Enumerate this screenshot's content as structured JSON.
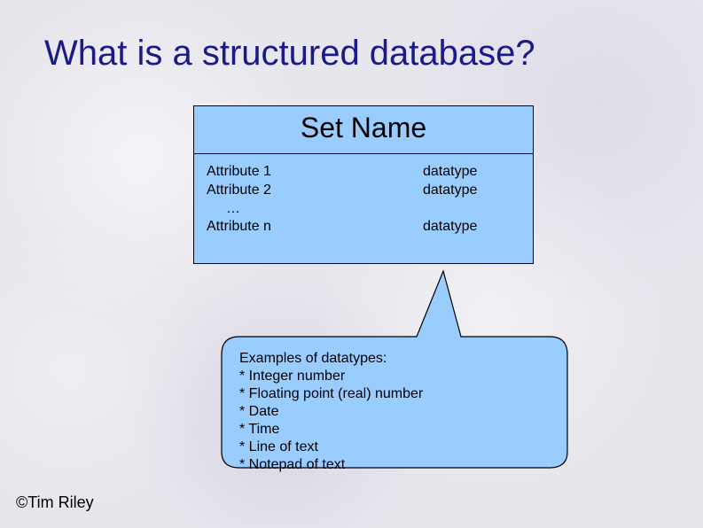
{
  "title": "What is a structured database?",
  "set": {
    "name": "Set Name",
    "rows": {
      "attr1": "Attribute 1",
      "attr2": "Attribute 2",
      "dots": "…",
      "attrN": "Attribute n",
      "dt1": "datatype",
      "dt2": "datatype",
      "dtN": "datatype"
    }
  },
  "callout": {
    "heading": "Examples of datatypes:",
    "items": {
      "i1": "* Integer number",
      "i2": "* Floating point (real) number",
      "i3": "* Date",
      "i4": "* Time",
      "i5": "* Line of text",
      "i6": "* Notepad of text"
    }
  },
  "copyright": "©Tim Riley",
  "colors": {
    "title": "#1a1a8a",
    "box_fill": "#99ccff"
  }
}
